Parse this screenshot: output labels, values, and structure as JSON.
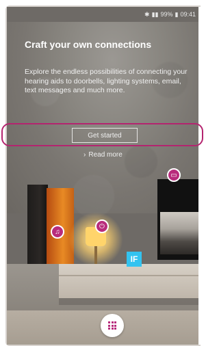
{
  "status_bar": {
    "bluetooth_icon": "bluetooth-icon",
    "battery": "99%",
    "time": "09:41"
  },
  "intro": {
    "title": "Craft your own connections",
    "description": "Explore the endless possibilities of connecting your hearing aids to doorbells, lighting systems, email, text messages and much more."
  },
  "actions": {
    "get_started": "Get started",
    "read_more": "Read more"
  },
  "services": {
    "ifttt_label": "IF"
  },
  "colors": {
    "accent": "#b82c7c",
    "ifttt": "#33c3f0"
  }
}
